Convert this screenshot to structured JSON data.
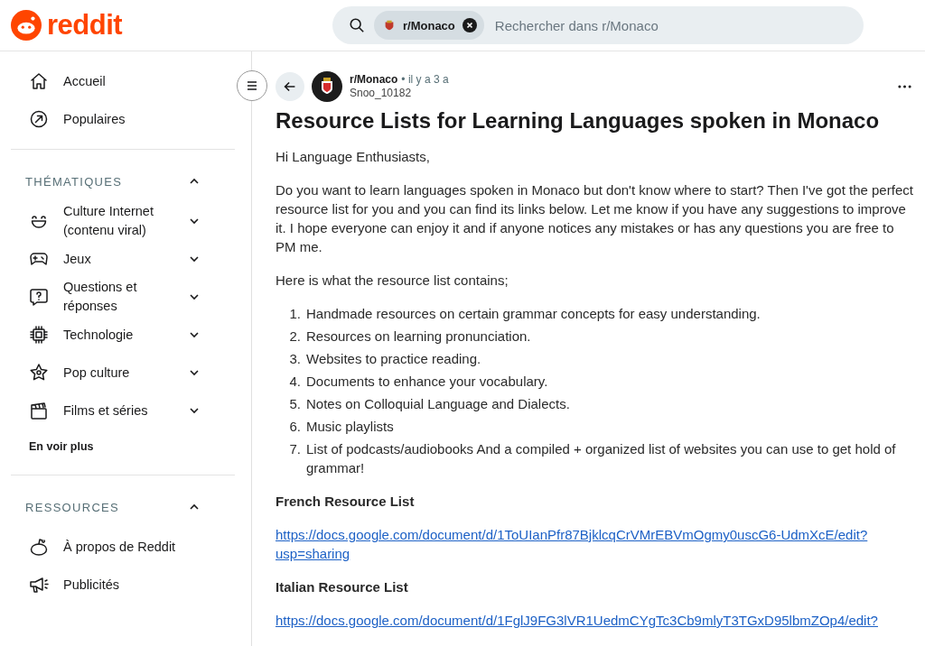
{
  "header": {
    "logo": "reddit",
    "search": {
      "chip": "r/Monaco",
      "placeholder": "Rechercher dans r/Monaco"
    }
  },
  "sidebar": {
    "top_items": [
      {
        "label": "Accueil"
      },
      {
        "label": "Populaires"
      }
    ],
    "sections": [
      {
        "title": "THÉMATIQUES",
        "expanded": true,
        "items": [
          {
            "label": "Culture Internet (contenu viral)",
            "expanded": false
          },
          {
            "label": "Jeux",
            "expanded": false
          },
          {
            "label": "Questions et réponses",
            "expanded": false
          },
          {
            "label": "Technologie",
            "expanded": false
          },
          {
            "label": "Pop culture",
            "expanded": false
          },
          {
            "label": "Films et séries",
            "expanded": false
          }
        ],
        "more": "En voir plus"
      },
      {
        "title": "RESSOURCES",
        "expanded": true,
        "items": [
          {
            "label": "À propos de Reddit"
          },
          {
            "label": "Publicités"
          }
        ]
      }
    ]
  },
  "post": {
    "subreddit": "r/Monaco",
    "age": "• il y a 3 a",
    "author": "Snoo_10182",
    "title": "Resource Lists for Learning Languages spoken in Monaco",
    "body": [
      {
        "kind": "para",
        "text": "Hi Language Enthusiasts,"
      },
      {
        "kind": "para",
        "text": "Do you want to learn languages spoken in Monaco but don't know where to start? Then I've got the perfect resource list for you and you can find its links below. Let me know if you have any suggestions to improve it. I hope everyone can enjoy it and if anyone notices any mistakes or has any questions you are free to PM me."
      },
      {
        "kind": "para",
        "text": "Here is what the resource list contains;"
      },
      {
        "kind": "list",
        "items": [
          {
            "number": "1.",
            "text": "Handmade resources on certain grammar concepts for easy understanding."
          },
          {
            "number": "2.",
            "text": "Resources on learning pronunciation."
          },
          {
            "number": "3.",
            "text": "Websites to practice reading."
          },
          {
            "number": "4.",
            "text": "Documents to enhance your vocabulary."
          },
          {
            "number": "5.",
            "text": "Notes on Colloquial Language and Dialects."
          },
          {
            "number": "6.",
            "text": "Music playlists"
          },
          {
            "number": "7.",
            "text": "List of podcasts/audiobooks And a compiled + organized list of websites you can use to get hold of grammar!"
          }
        ]
      },
      {
        "kind": "heading",
        "text": "French Resource List"
      },
      {
        "kind": "link",
        "text": "https://docs.google.com/document/d/1ToUIanPfr87BjklcqCrVMrEBVmOgmy0uscG6-UdmXcE/edit?usp=sharing"
      },
      {
        "kind": "heading",
        "text": "Italian Resource List"
      },
      {
        "kind": "link",
        "text": "https://docs.google.com/document/d/1FglJ9FG3lVR1UedmCYgTc3Cb9mlyT3TGxD95lbmZOp4/edit?"
      }
    ]
  }
}
